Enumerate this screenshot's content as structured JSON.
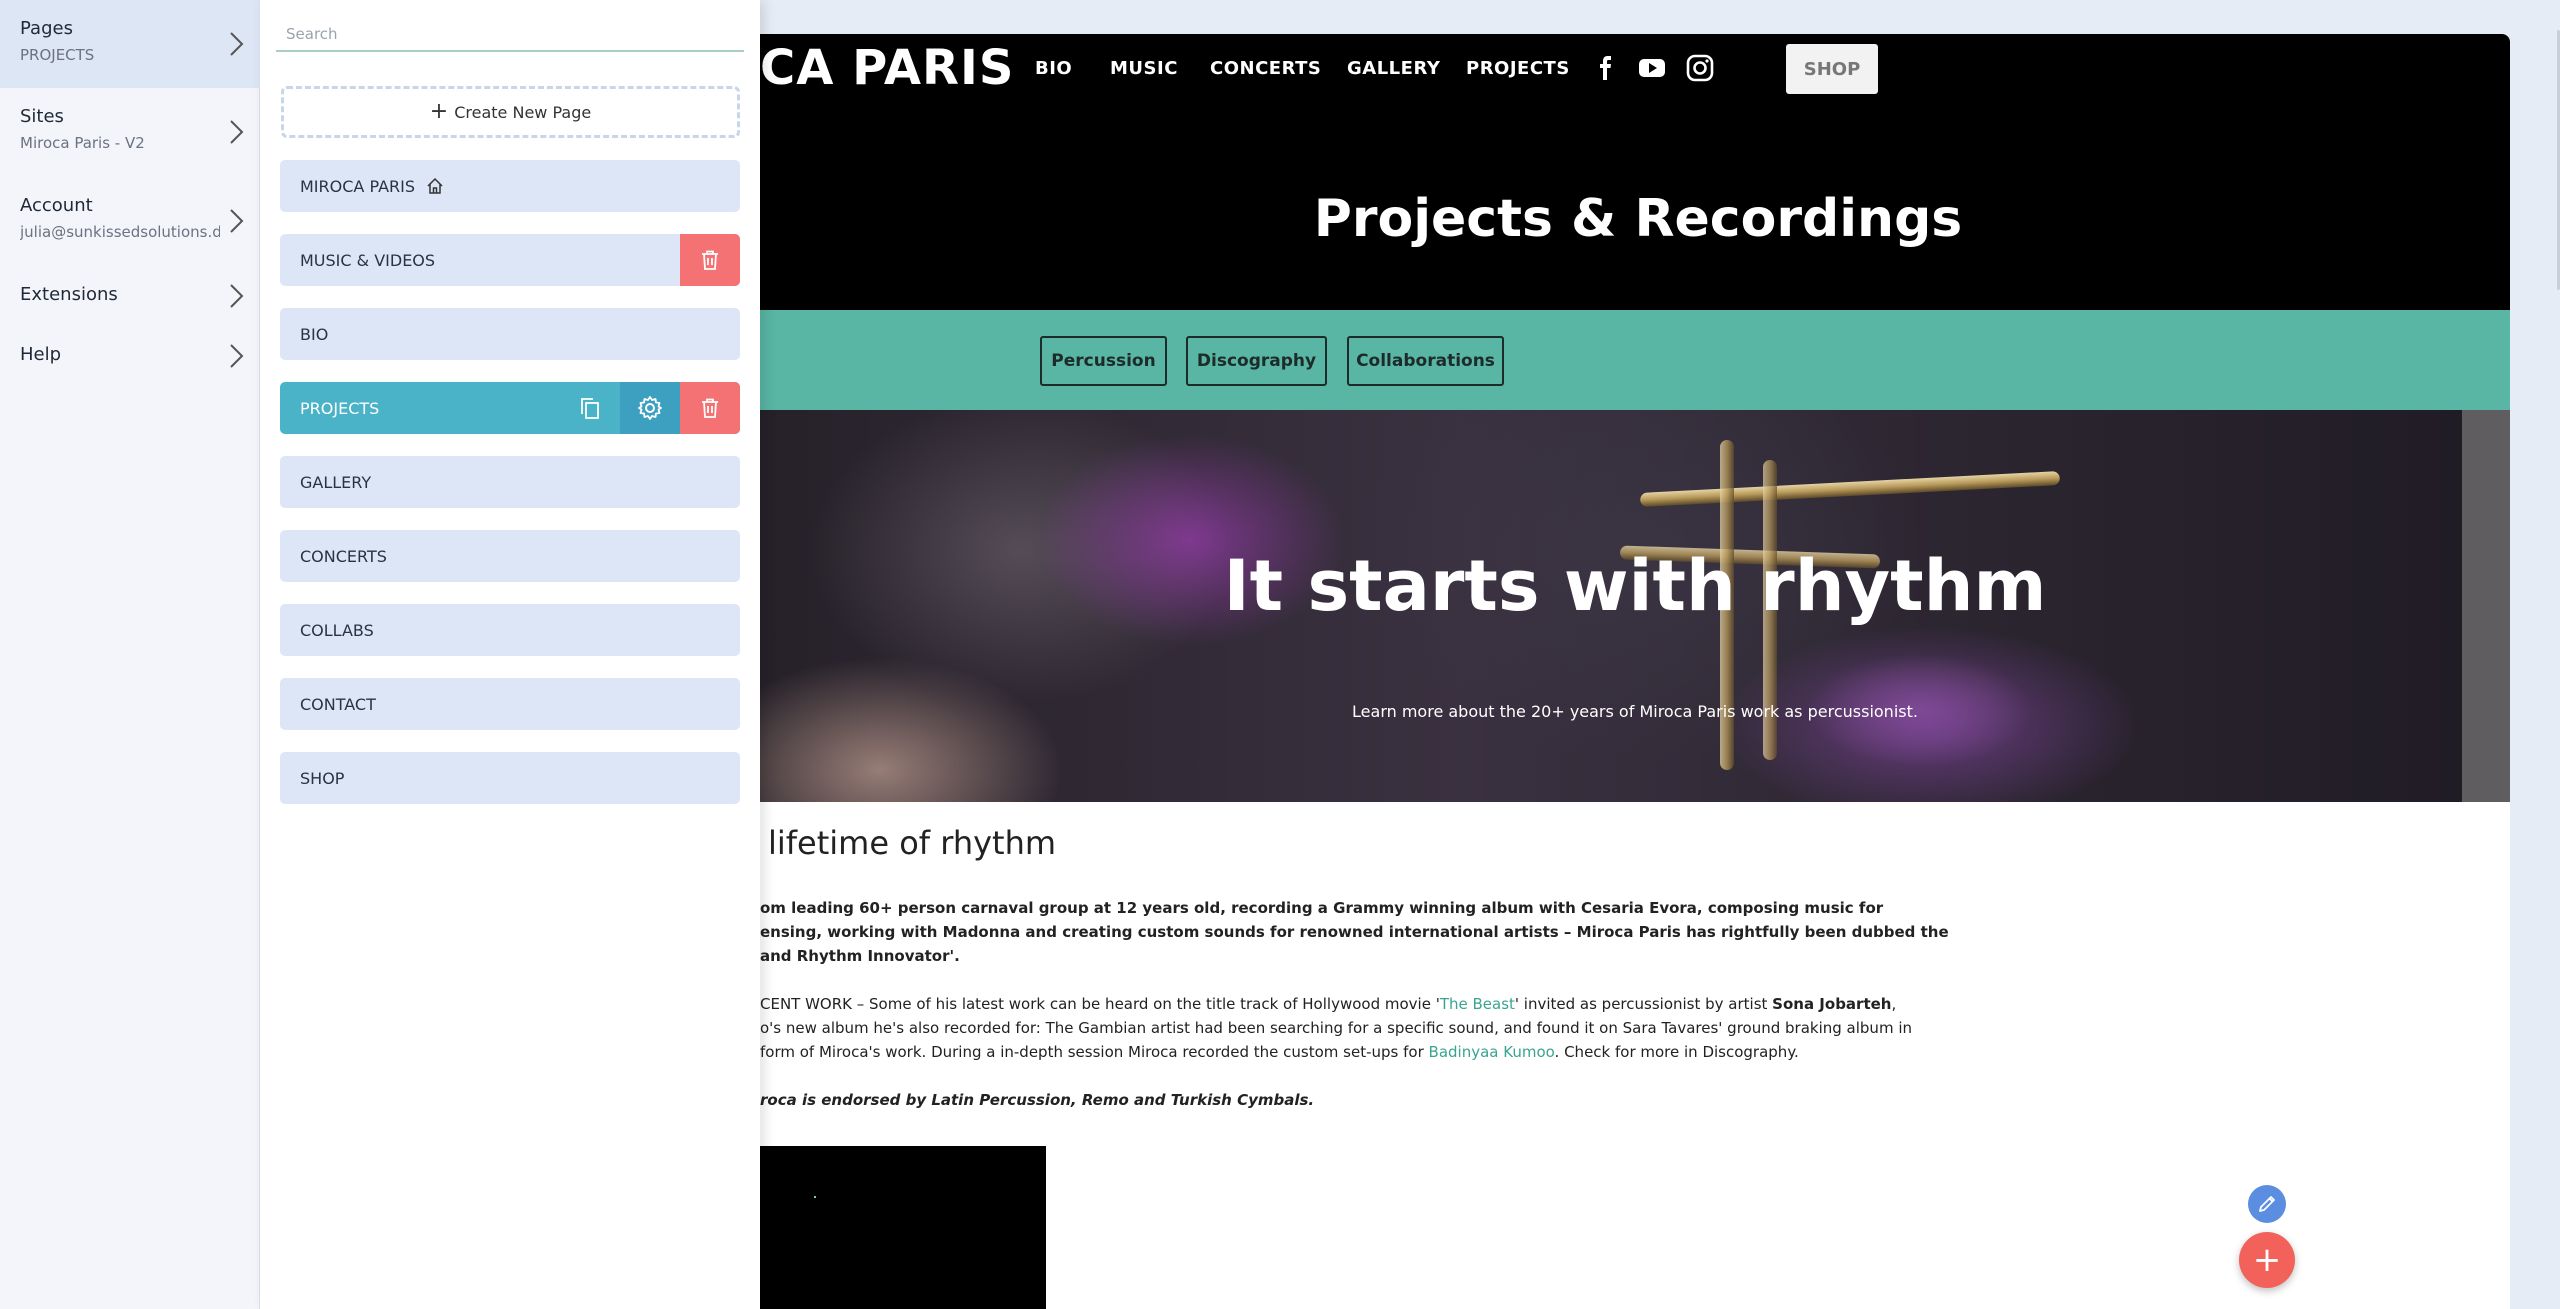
{
  "left_nav": {
    "items": [
      {
        "title": "Pages",
        "sub": "PROJECTS"
      },
      {
        "title": "Sites",
        "sub": "Miroca Paris - V2"
      },
      {
        "title": "Account",
        "sub": "julia@sunkissedsolutions.de"
      },
      {
        "title": "Extensions",
        "sub": ""
      },
      {
        "title": "Help",
        "sub": ""
      }
    ]
  },
  "pages_panel": {
    "search_placeholder": "Search",
    "create_label": "Create New Page",
    "pages": [
      {
        "label": "MIROCA PARIS"
      },
      {
        "label": "MUSIC & VIDEOS"
      },
      {
        "label": "BIO"
      },
      {
        "label": "PROJECTS"
      },
      {
        "label": "GALLERY"
      },
      {
        "label": "CONCERTS"
      },
      {
        "label": "COLLABS"
      },
      {
        "label": "CONTACT"
      },
      {
        "label": "SHOP"
      }
    ]
  },
  "site": {
    "logo": "CA PARIS",
    "menu": [
      "BIO",
      "MUSIC",
      "CONCERTS",
      "GALLERY",
      "PROJECTS"
    ],
    "shop_label": "SHOP",
    "hero_heading": "Projects & Recordings",
    "tabs": [
      "Percussion",
      "Discography",
      "Collaborations"
    ],
    "banner_title": "It starts with rhythm",
    "banner_subtitle": "Learn more about the 20+ years of Miroca Paris work as percussionist.",
    "section_title": "lifetime of rhythm",
    "intro_lines": [
      "om leading 60+ person carnaval group at 12 years old, recording a Grammy winning album with Cesaria Evora, composing music for",
      "ensing, working with Madonna and creating custom sounds for renowned international artists – Miroca Paris has rightfully been dubbed the",
      "and Rhythm Innovator'."
    ],
    "recent": {
      "l1_a": "CENT WORK – Some of his latest work can be heard on the title track of Hollywood movie '",
      "l1_link": "The Beast",
      "l1_b": "' invited as percussionist by artist ",
      "l1_bold": "Sona Jobarteh",
      "l1_c": ",",
      "l2": "o's new album he's also recorded for: The Gambian artist had been searching for a specific sound, and found it on Sara Tavares' ground braking album in",
      "l3_a": "form of Miroca's work. During a in-depth session Miroca recorded the custom set-ups for ",
      "l3_link": "Badinyaa Kumoo",
      "l3_b": ". Check for more in Discography."
    },
    "endorsement": "roca is endorsed by Latin Percussion, Remo and Turkish Cymbals."
  },
  "colors": {
    "accent_teal": "#59b5a4",
    "selected_page": "#4ab3c7",
    "delete_red": "#f47174",
    "fab_red": "#f2625a",
    "fab_blue": "#5b8de0"
  },
  "icons": [
    "chevron-right-icon",
    "home-icon",
    "copy-icon",
    "gear-icon",
    "trash-icon",
    "facebook-icon",
    "youtube-icon",
    "instagram-icon",
    "pencil-icon",
    "plus-icon"
  ]
}
